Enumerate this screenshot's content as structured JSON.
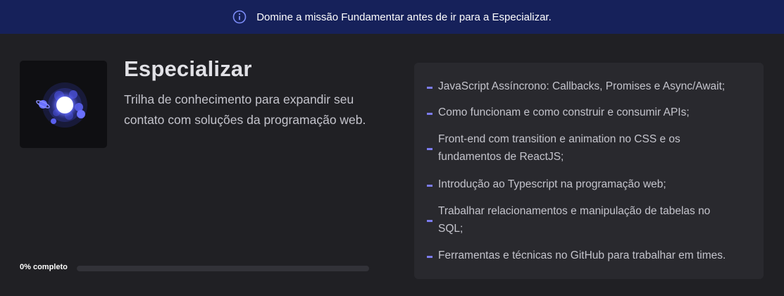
{
  "banner": {
    "icon": "info-circle-icon",
    "text": "Domine a missão Fundamentar antes de ir para a Especializar.",
    "color": "#16215a"
  },
  "track": {
    "image_icon": "planet-orbit-icon",
    "title": "Especializar",
    "description": "Trilha de conhecimento para expandir seu contato com soluções da programação web.",
    "progress_label": "0% completo",
    "progress_value": 0
  },
  "topics": [
    "JavaScript Assíncrono: Callbacks, Promises e Async/Await;",
    "Como funcionam e como construir e consumir APIs;",
    "Front-end com transition e animation no CSS e os fundamentos de ReactJS;",
    "Introdução ao Typescript na programação web;",
    "Trabalhar relacionamentos e manipulação de tabelas no SQL;",
    "Ferramentas e técnicas no GitHub para trabalhar em times."
  ],
  "colors": {
    "background": "#202024",
    "panel": "#29292e",
    "bullet": "#7c7cf0"
  }
}
